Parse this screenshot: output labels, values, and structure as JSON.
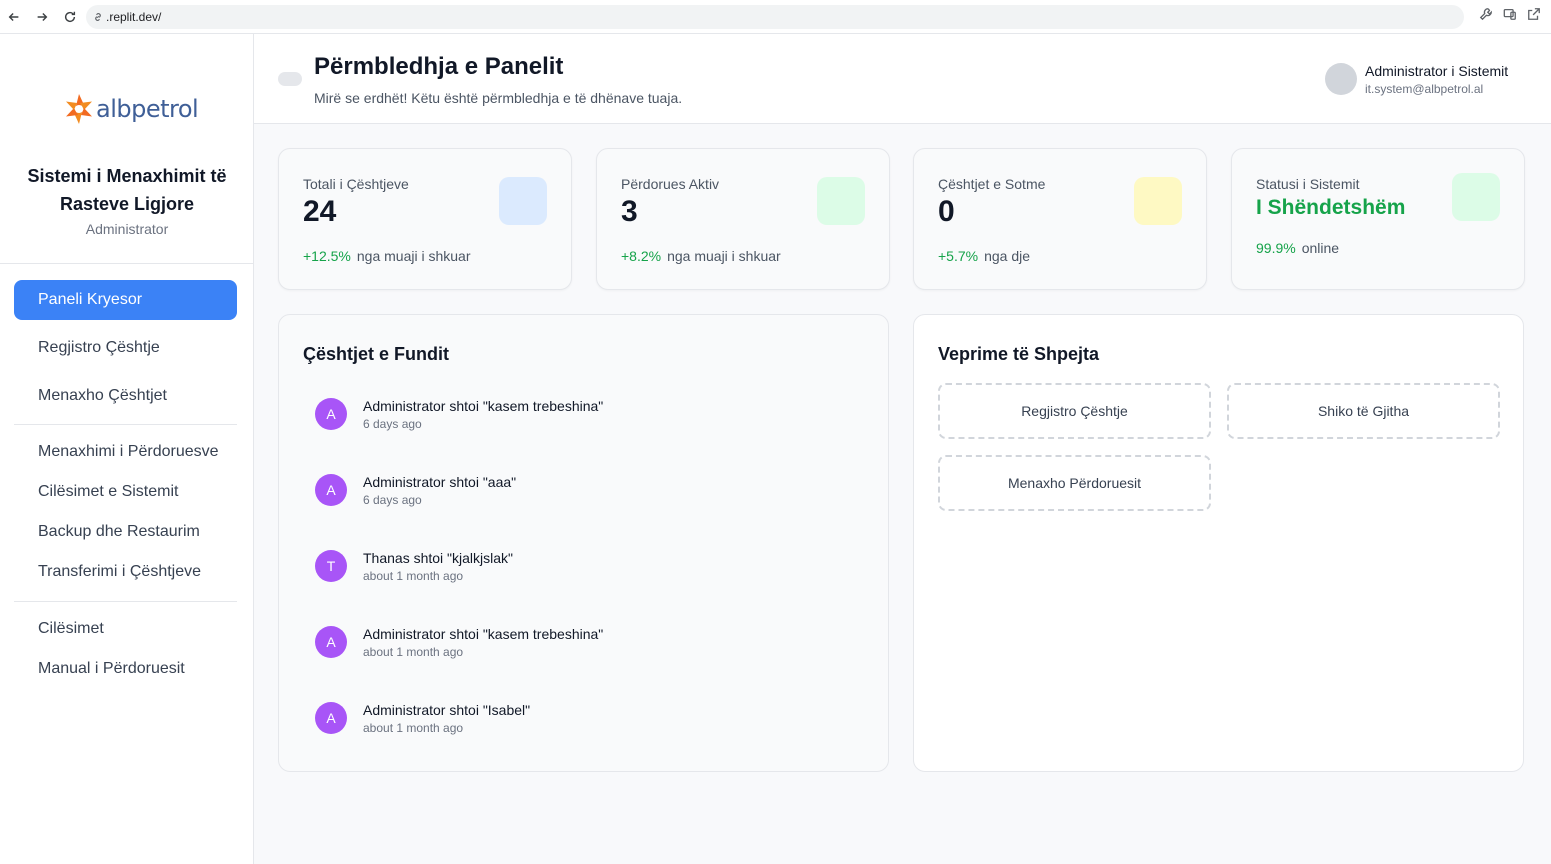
{
  "browser": {
    "url": ".replit.dev/"
  },
  "sidebar": {
    "logo_text": "albpetrol",
    "system_title_line1": "Sistemi i Menaxhimit të",
    "system_title_line2": "Rasteve Ligjore",
    "role": "Administrator",
    "items": [
      {
        "label": "Paneli Kryesor",
        "active": true
      },
      {
        "label": "Regjistro Çështje"
      },
      {
        "label": "Menaxho Çështjet"
      },
      {
        "label": "Menaxhimi i Përdoruesve"
      },
      {
        "label": "Cilësimet e Sistemit"
      },
      {
        "label": "Backup dhe Restaurim"
      },
      {
        "label": "Transferimi i Çështjeve"
      },
      {
        "label": "Cilësimet"
      },
      {
        "label": "Manual i Përdoruesit"
      }
    ]
  },
  "header": {
    "title": "Përmbledhja e Panelit",
    "subtitle": "Mirë se erdhët! Këtu është përmbledhja e të dhënave tuaja.",
    "user_name": "Administrator i Sistemit",
    "user_email": "it.system@albpetrol.al"
  },
  "stats": [
    {
      "label": "Totali i Çështjeve",
      "value": "24",
      "change": "+12.5%",
      "change_text": "nga muaji i shkuar",
      "icon_color": "#dbeafe"
    },
    {
      "label": "Përdorues Aktiv",
      "value": "3",
      "change": "+8.2%",
      "change_text": "nga muaji i shkuar",
      "icon_color": "#dcfce7"
    },
    {
      "label": "Çështjet e Sotme",
      "value": "0",
      "change": "+5.7%",
      "change_text": "nga dje",
      "icon_color": "#fef9c3"
    },
    {
      "label": "Statusi i Sistemit",
      "value": "I Shëndetshëm",
      "change": "99.9%",
      "change_text": "online",
      "icon_color": "#dcfce7"
    }
  ],
  "recent": {
    "title": "Çështjet e Fundit",
    "items": [
      {
        "initial": "A",
        "text": "Administrator shtoi \"kasem trebeshina\"",
        "time": "6 days ago"
      },
      {
        "initial": "A",
        "text": "Administrator shtoi \"aaa\"",
        "time": "6 days ago"
      },
      {
        "initial": "T",
        "text": "Thanas shtoi \"kjalkjslak\"",
        "time": "about 1 month ago"
      },
      {
        "initial": "A",
        "text": "Administrator shtoi \"kasem trebeshina\"",
        "time": "about 1 month ago"
      },
      {
        "initial": "A",
        "text": "Administrator shtoi \"Isabel\"",
        "time": "about 1 month ago"
      }
    ]
  },
  "quick": {
    "title": "Veprime të Shpejta",
    "buttons": [
      "Regjistro Çështje",
      "Shiko të Gjitha",
      "Menaxho Përdoruesit"
    ]
  },
  "colors": {
    "accent": "#3b82f6",
    "success": "#16a34a",
    "avatar_purple": "#a855f7"
  }
}
